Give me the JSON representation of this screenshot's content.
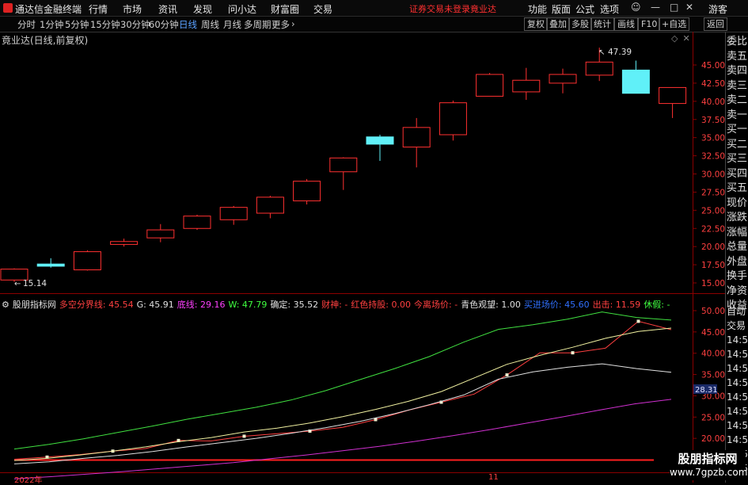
{
  "app_title": "通达信金融终端",
  "menu": [
    "行情",
    "市场",
    "资讯",
    "发现",
    "问小达",
    "财富圈",
    "交易"
  ],
  "warning": "证券交易未登录",
  "stock_name_menu": "竟业达",
  "right_menu": [
    "功能",
    "版面",
    "公式",
    "选项"
  ],
  "guest": "游客",
  "toolbar_left": [
    "分时",
    "1分钟",
    "5分钟",
    "15分钟",
    "30分钟",
    "60分钟",
    "日线",
    "周线",
    "月线",
    "多周期",
    "更多"
  ],
  "toolbar_active": "日线",
  "toolbar_right": [
    "复权",
    "叠加",
    "多股",
    "统计",
    "画线",
    "F10",
    "+自选",
    "返回"
  ],
  "chart_title": "竟业达(日线,前复权)",
  "price_high_label": "47.39",
  "price_low_label": "15.14",
  "indicator": {
    "name": "股朋指标网",
    "items": [
      {
        "label": "多空分界线: 45.54",
        "color": "#ff4040"
      },
      {
        "label": "G: 45.91",
        "color": "#e0e0e0"
      },
      {
        "label": "底线: 29.16",
        "color": "#ff40ff"
      },
      {
        "label": "W: 47.79",
        "color": "#40ff40"
      },
      {
        "label": "确定: 35.52",
        "color": "#e0e0e0"
      },
      {
        "label": "财神: -",
        "color": "#ff4040"
      },
      {
        "label": "红色持股: 0.00",
        "color": "#ff4040"
      },
      {
        "label": "今离场价: -",
        "color": "#ff4040"
      },
      {
        "label": "青色观望: 1.00",
        "color": "#e0e0e0"
      },
      {
        "label": "买进场价: 45.60",
        "color": "#3070ff"
      },
      {
        "label": "出击: 11.59",
        "color": "#ff4040"
      },
      {
        "label": "休假: -",
        "color": "#40ff40"
      }
    ]
  },
  "sidebar": [
    "委比",
    "卖五",
    "卖四",
    "卖三",
    "卖二",
    "卖一",
    "买一",
    "买二",
    "买三",
    "买四",
    "买五",
    "现价",
    "涨跌",
    "涨幅",
    "总量",
    "外盘",
    "换手",
    "净资",
    "收益"
  ],
  "sidebar2": [
    "自动",
    "交易",
    "14:56",
    "14:56",
    "14:56",
    "14:56",
    "14:56",
    "14:56",
    "14:56",
    "14:56",
    "14:56",
    "14:56"
  ],
  "price_axis": [
    "45.00",
    "42.50",
    "40.00",
    "37.50",
    "35.00",
    "32.50",
    "30.00",
    "27.50",
    "25.00",
    "22.50",
    "20.00",
    "17.50",
    "15.00"
  ],
  "ind_axis": [
    "50.00",
    "45.00",
    "40.00",
    "35.00",
    "30.00",
    "25.00",
    "20.00",
    "15.00"
  ],
  "ind_current": "28.31",
  "x_labels": {
    "year": "2022年",
    "month": "11"
  },
  "watermark": {
    "line1": "股朋指标网",
    "line2": "www.7gpzb.com"
  },
  "colors": {
    "up": "#ff3030",
    "down": "#60f0f8",
    "bg": "#000000"
  },
  "chart_data": {
    "type": "candlestick",
    "price_ylim": [
      15.0,
      45.0
    ],
    "candles": [
      {
        "o": 15.4,
        "c": 16.9,
        "h": 17.0,
        "l": 15.14,
        "up": true
      },
      {
        "o": 17.6,
        "c": 17.3,
        "h": 18.4,
        "l": 17.1,
        "up": false
      },
      {
        "o": 16.8,
        "c": 19.3,
        "h": 19.5,
        "l": 16.7,
        "up": true
      },
      {
        "o": 20.3,
        "c": 20.7,
        "h": 21.1,
        "l": 20.0,
        "up": true
      },
      {
        "o": 21.2,
        "c": 22.3,
        "h": 23.1,
        "l": 20.6,
        "up": true
      },
      {
        "o": 22.5,
        "c": 24.2,
        "h": 24.4,
        "l": 22.3,
        "up": true
      },
      {
        "o": 23.7,
        "c": 25.4,
        "h": 25.6,
        "l": 23.0,
        "up": true
      },
      {
        "o": 24.6,
        "c": 26.8,
        "h": 27.0,
        "l": 23.9,
        "up": true
      },
      {
        "o": 26.3,
        "c": 29.0,
        "h": 29.3,
        "l": 25.8,
        "up": true
      },
      {
        "o": 30.3,
        "c": 32.2,
        "h": 32.3,
        "l": 27.8,
        "up": true
      },
      {
        "o": 35.1,
        "c": 34.1,
        "h": 35.4,
        "l": 31.8,
        "up": false
      },
      {
        "o": 33.7,
        "c": 36.4,
        "h": 37.7,
        "l": 30.9,
        "up": true
      },
      {
        "o": 35.4,
        "c": 39.8,
        "h": 40.1,
        "l": 34.6,
        "up": true
      },
      {
        "o": 40.7,
        "c": 43.7,
        "h": 43.9,
        "l": 40.7,
        "up": true
      },
      {
        "o": 41.3,
        "c": 42.9,
        "h": 44.6,
        "l": 40.2,
        "up": true
      },
      {
        "o": 42.5,
        "c": 43.7,
        "h": 44.5,
        "l": 41.1,
        "up": true
      },
      {
        "o": 43.6,
        "c": 45.4,
        "h": 47.39,
        "l": 42.8,
        "up": true
      },
      {
        "o": 44.3,
        "c": 41.1,
        "h": 45.6,
        "l": 41.1,
        "up": false
      },
      {
        "o": 39.7,
        "c": 41.9,
        "h": 41.9,
        "l": 37.7,
        "up": true
      }
    ],
    "ind_ylim": [
      15.0,
      50.0
    ],
    "series": [
      {
        "name": "W",
        "color": "#40e040",
        "values": [
          17.5,
          18.6,
          19.9,
          21.4,
          22.9,
          24.5,
          25.9,
          27.3,
          29.0,
          31.2,
          33.8,
          36.4,
          39.2,
          42.6,
          45.6,
          46.7,
          48.0,
          49.7,
          48.4,
          47.79
        ]
      },
      {
        "name": "多空分界线",
        "color": "#ff4040",
        "values": [
          15.1,
          15.6,
          16.2,
          17.0,
          17.6,
          19.5,
          19.4,
          20.5,
          21.1,
          21.7,
          22.6,
          24.4,
          26.6,
          28.5,
          30.4,
          34.9,
          40.1,
          40.1,
          41.2,
          47.5,
          45.54
        ]
      },
      {
        "name": "G",
        "color": "#f0f0a0",
        "values": [
          14.8,
          15.3,
          16.1,
          17.0,
          18.0,
          19.2,
          20.2,
          21.5,
          22.4,
          23.6,
          25.1,
          26.8,
          28.7,
          31.0,
          34.2,
          37.4,
          39.5,
          41.4,
          43.5,
          45.1,
          45.91
        ]
      },
      {
        "name": "确定",
        "color": "#e0e0e0",
        "values": [
          14.0,
          14.5,
          15.3,
          16.0,
          16.9,
          18.0,
          19.0,
          20.0,
          21.2,
          22.5,
          24.0,
          25.8,
          27.9,
          30.2,
          33.9,
          35.6,
          36.7,
          37.5,
          36.4,
          35.52
        ]
      },
      {
        "name": "底线",
        "color": "#d030d0",
        "values": [
          10.5,
          11.0,
          11.6,
          12.2,
          12.9,
          13.6,
          14.3,
          15.2,
          16.1,
          17.1,
          18.1,
          19.3,
          20.6,
          22.0,
          23.5,
          25.0,
          26.6,
          28.1,
          29.16
        ]
      }
    ]
  }
}
